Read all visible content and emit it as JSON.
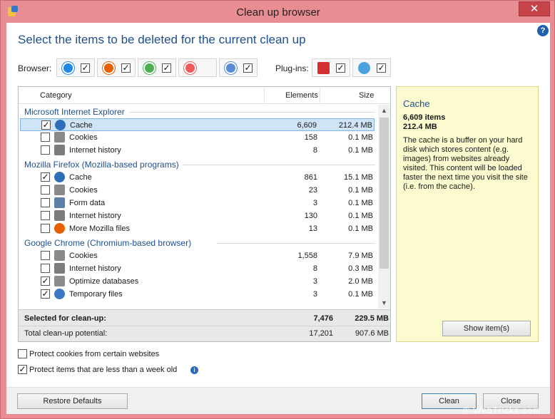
{
  "window": {
    "title": "Clean up browser",
    "close_glyph": "✕"
  },
  "heading": "Select the items to be deleted for the current clean up",
  "help_glyph": "?",
  "browsers_label": "Browser:",
  "plugins_label": "Plug-ins:",
  "browsers": [
    {
      "icon": "ie-icon",
      "color": "#1e88e5",
      "checked": true
    },
    {
      "icon": "firefox-icon",
      "color": "#e66000",
      "checked": true
    },
    {
      "icon": "chrome-icon",
      "color": "#4caf50",
      "checked": true
    },
    {
      "icon": "opera-icon",
      "color": "#f05a5a",
      "checked": false
    },
    {
      "icon": "safari-icon",
      "color": "#5a8bd6",
      "checked": true
    }
  ],
  "plugins": [
    {
      "icon": "flash-icon",
      "color": "#d32f2f",
      "checked": true
    },
    {
      "icon": "silverlight-icon",
      "color": "#4aa3df",
      "checked": true
    }
  ],
  "columns": {
    "category": "Category",
    "elements": "Elements",
    "size": "Size"
  },
  "groups": [
    {
      "name": "Microsoft Internet Explorer",
      "items": [
        {
          "name": "Cache",
          "elements": "6,609",
          "size": "212.4 MB",
          "checked": true,
          "selected": true,
          "icon": "cache-icon"
        },
        {
          "name": "Cookies",
          "elements": "158",
          "size": "0.1 MB",
          "checked": false,
          "icon": "cookies-icon"
        },
        {
          "name": "Internet history",
          "elements": "8",
          "size": "0.1 MB",
          "checked": false,
          "icon": "history-icon"
        }
      ]
    },
    {
      "name": "Mozilla Firefox (Mozilla-based programs)",
      "items": [
        {
          "name": "Cache",
          "elements": "861",
          "size": "15.1 MB",
          "checked": true,
          "icon": "cache-icon"
        },
        {
          "name": "Cookies",
          "elements": "23",
          "size": "0.1 MB",
          "checked": false,
          "icon": "cookies-icon"
        },
        {
          "name": "Form data",
          "elements": "3",
          "size": "0.1 MB",
          "checked": false,
          "icon": "form-data-icon"
        },
        {
          "name": "Internet history",
          "elements": "130",
          "size": "0.1 MB",
          "checked": false,
          "icon": "history-icon"
        },
        {
          "name": "More Mozilla files",
          "elements": "13",
          "size": "0.1 MB",
          "checked": false,
          "icon": "firefox-icon"
        }
      ]
    },
    {
      "name": "Google Chrome (Chromium-based browser)",
      "items": [
        {
          "name": "Cookies",
          "elements": "1,558",
          "size": "7.9 MB",
          "checked": false,
          "icon": "cookies-icon"
        },
        {
          "name": "Internet history",
          "elements": "8",
          "size": "0.3 MB",
          "checked": false,
          "icon": "history-icon"
        },
        {
          "name": "Optimize databases",
          "elements": "3",
          "size": "2.0 MB",
          "checked": true,
          "icon": "database-icon"
        },
        {
          "name": "Temporary files",
          "elements": "3",
          "size": "0.1 MB",
          "checked": true,
          "icon": "temp-files-icon"
        }
      ]
    }
  ],
  "summary": {
    "selected_label": "Selected for clean-up:",
    "selected_elements": "7,476",
    "selected_size": "229.5 MB",
    "total_label": "Total clean-up potential:",
    "total_elements": "17,201",
    "total_size": "907.6 MB"
  },
  "info": {
    "title": "Cache",
    "count": "6,609 items",
    "size": "212.4 MB",
    "description": "The cache is a buffer on your hard disk which stores content (e.g. images) from websites already visited. This content will be loaded faster the next time you visit the site (i.e. from the cache).",
    "show_button": "Show item(s)"
  },
  "options": [
    {
      "label": "Protect cookies from certain websites",
      "checked": false
    },
    {
      "label": "Protect items that are less than a week old",
      "checked": true
    }
  ],
  "info_glyph": "i",
  "buttons": {
    "restore": "Restore Defaults",
    "clean": "Clean",
    "close": "Close"
  },
  "watermark": "© WebTrickz.com"
}
